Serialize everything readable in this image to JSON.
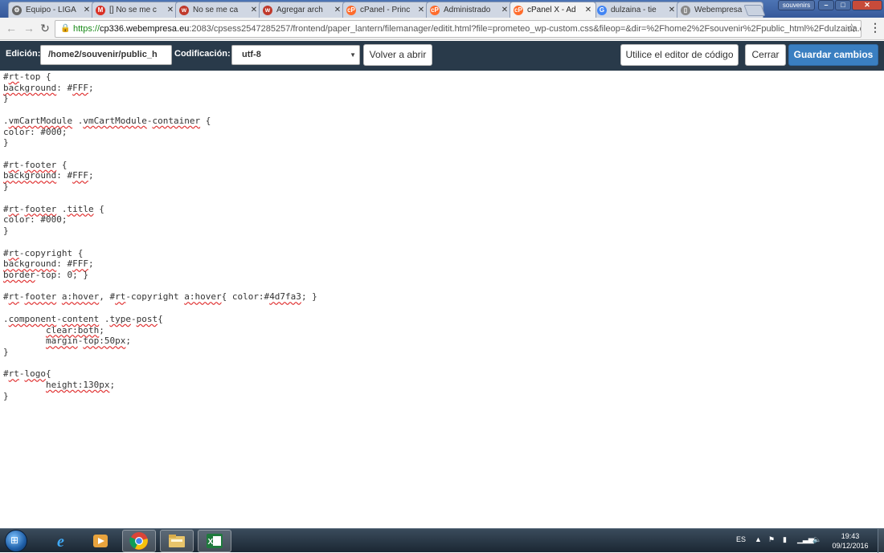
{
  "browser": {
    "tabs": [
      {
        "label": "Equipo - LIGA",
        "icon": "gear-favicon"
      },
      {
        "label": "[] No se me c",
        "icon": "gmail-favicon"
      },
      {
        "label": "No se me ca",
        "icon": "w-favicon"
      },
      {
        "label": "Agregar arch",
        "icon": "w-favicon"
      },
      {
        "label": "cPanel - Princ",
        "icon": "cpanel-favicon"
      },
      {
        "label": "Administrado",
        "icon": "cpanel-favicon"
      },
      {
        "label": "cPanel X - Ad",
        "icon": "cpanel-favicon",
        "active": true
      },
      {
        "label": "dulzaina - tie",
        "icon": "google-favicon"
      },
      {
        "label": "Webempresa",
        "icon": "document-favicon"
      }
    ],
    "profile_label": "souvenirs",
    "url_scheme": "https://",
    "url_host": "cp336.webempresa.eu",
    "url_rest": ":2083/cpsess2547285257/frontend/paper_lantern/filemanager/editit.html?file=prometeo_wp-custom.css&fileop=&dir=%2Fhome2%2Fsouvenir%2Fpublic_html%2Fdulzaina.cc"
  },
  "toolbar": {
    "edition_label": "Edición:",
    "path_value": "/home2/souvenir/public_h",
    "encoding_label": "Codificación:",
    "encoding_value": "utf-8",
    "reopen_label": "Volver a abrir",
    "code_editor_label": "Utilice el editor de código",
    "close_label": "Cerrar",
    "save_label": "Guardar cambios"
  },
  "editor": {
    "lines": [
      [
        {
          "t": "#"
        },
        {
          "t": "rt",
          "sq": true
        },
        {
          "t": "-top {"
        }
      ],
      [
        {
          "t": "background",
          "sq": true
        },
        {
          "t": ": #"
        },
        {
          "t": "FFF",
          "sq": true
        },
        {
          "t": ";"
        }
      ],
      [
        {
          "t": "}"
        }
      ],
      [
        {
          "t": ""
        }
      ],
      [
        {
          "t": "."
        },
        {
          "t": "vmCartModule",
          "sq": true
        },
        {
          "t": " ."
        },
        {
          "t": "vmCartModule",
          "sq": true
        },
        {
          "t": "-"
        },
        {
          "t": "container",
          "sq": true
        },
        {
          "t": " {"
        }
      ],
      [
        {
          "t": "color: #000;"
        }
      ],
      [
        {
          "t": "}"
        }
      ],
      [
        {
          "t": ""
        }
      ],
      [
        {
          "t": "#"
        },
        {
          "t": "rt",
          "sq": true
        },
        {
          "t": "-"
        },
        {
          "t": "footer",
          "sq": true
        },
        {
          "t": " {"
        }
      ],
      [
        {
          "t": "background",
          "sq": true
        },
        {
          "t": ": #"
        },
        {
          "t": "FFF",
          "sq": true
        },
        {
          "t": ";"
        }
      ],
      [
        {
          "t": "}"
        }
      ],
      [
        {
          "t": ""
        }
      ],
      [
        {
          "t": "#"
        },
        {
          "t": "rt",
          "sq": true
        },
        {
          "t": "-"
        },
        {
          "t": "footer",
          "sq": true
        },
        {
          "t": " ."
        },
        {
          "t": "title",
          "sq": true
        },
        {
          "t": " {"
        }
      ],
      [
        {
          "t": "color: #000;"
        }
      ],
      [
        {
          "t": "}"
        }
      ],
      [
        {
          "t": ""
        }
      ],
      [
        {
          "t": "#"
        },
        {
          "t": "rt",
          "sq": true
        },
        {
          "t": "-copyright {"
        }
      ],
      [
        {
          "t": "background",
          "sq": true
        },
        {
          "t": ": #"
        },
        {
          "t": "FFF",
          "sq": true
        },
        {
          "t": ";"
        }
      ],
      [
        {
          "t": "border",
          "sq": true
        },
        {
          "t": "-top: 0; }"
        }
      ],
      [
        {
          "t": ""
        }
      ],
      [
        {
          "t": "#"
        },
        {
          "t": "rt",
          "sq": true
        },
        {
          "t": "-"
        },
        {
          "t": "footer",
          "sq": true
        },
        {
          "t": " "
        },
        {
          "t": "a:hover",
          "sq": true
        },
        {
          "t": ", #"
        },
        {
          "t": "rt",
          "sq": true
        },
        {
          "t": "-copyright "
        },
        {
          "t": "a:hover",
          "sq": true
        },
        {
          "t": "{ color:#"
        },
        {
          "t": "4d7fa3",
          "sq": true
        },
        {
          "t": "; }"
        }
      ],
      [
        {
          "t": ""
        }
      ],
      [
        {
          "t": "."
        },
        {
          "t": "component",
          "sq": true
        },
        {
          "t": "-"
        },
        {
          "t": "content",
          "sq": true
        },
        {
          "t": " ."
        },
        {
          "t": "type",
          "sq": true
        },
        {
          "t": "-"
        },
        {
          "t": "post",
          "sq": true
        },
        {
          "t": "{"
        }
      ],
      [
        {
          "t": "        "
        },
        {
          "t": "clear:both",
          "sq": true
        },
        {
          "t": ";"
        }
      ],
      [
        {
          "t": "        "
        },
        {
          "t": "margin",
          "sq": true
        },
        {
          "t": "-"
        },
        {
          "t": "top:50px",
          "sq": true
        },
        {
          "t": ";"
        }
      ],
      [
        {
          "t": "}"
        }
      ],
      [
        {
          "t": ""
        }
      ],
      [
        {
          "t": "#"
        },
        {
          "t": "rt",
          "sq": true
        },
        {
          "t": "-"
        },
        {
          "t": "logo",
          "sq": true
        },
        {
          "t": "{"
        }
      ],
      [
        {
          "t": "        "
        },
        {
          "t": "height:130px",
          "sq": true
        },
        {
          "t": ";"
        }
      ],
      [
        {
          "t": "}"
        }
      ]
    ]
  },
  "taskbar": {
    "language": "ES",
    "time": "19:43",
    "date": "09/12/2016"
  }
}
